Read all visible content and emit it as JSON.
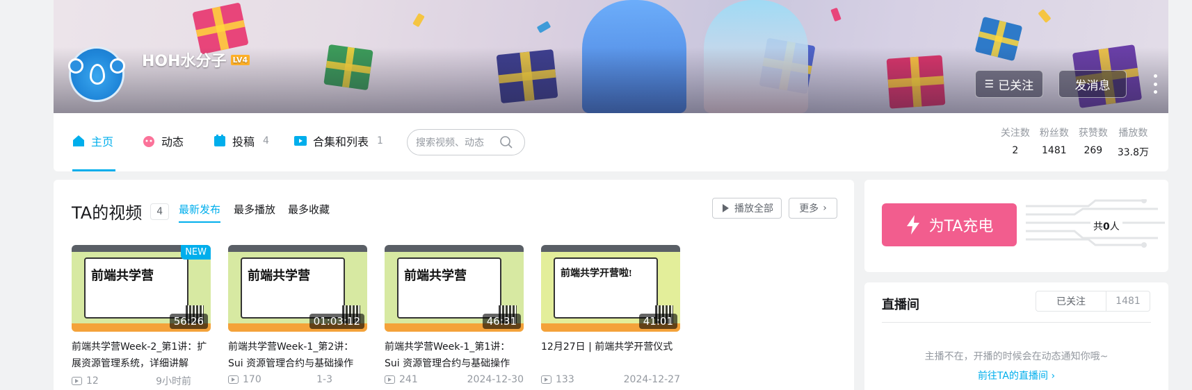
{
  "colors": {
    "accent": "#00aeec",
    "charge": "#f25d8e",
    "text": "#18191c",
    "muted": "#9499a0"
  },
  "profile": {
    "name": "HOH水分子",
    "level": "LV4",
    "followed_label": "已关注",
    "message_label": "发消息"
  },
  "nav": {
    "tabs": [
      {
        "label": "主页",
        "count": "",
        "icon": "home-icon"
      },
      {
        "label": "动态",
        "count": "",
        "icon": "dynamic-icon"
      },
      {
        "label": "投稿",
        "count": "4",
        "icon": "upload-icon"
      },
      {
        "label": "合集和列表",
        "count": "1",
        "icon": "collection-icon"
      }
    ],
    "search_placeholder": "搜索视频、动态",
    "stats": [
      {
        "label": "关注数",
        "value": "2"
      },
      {
        "label": "粉丝数",
        "value": "1481"
      },
      {
        "label": "获赞数",
        "value": "269"
      },
      {
        "label": "播放数",
        "value": "33.8万"
      }
    ]
  },
  "videos_section": {
    "title": "TA的视频",
    "count": "4",
    "sorts": [
      "最新发布",
      "最多播放",
      "最多收藏"
    ],
    "play_all_label": "播放全部",
    "more_label": "更多",
    "items": [
      {
        "title": "前端共学营Week-2_第1讲：扩展资源管理系统，详细讲解",
        "views": "12",
        "date": "9小时前",
        "duration": "56:26",
        "badge": "NEW",
        "thumb_title": "前端共学营"
      },
      {
        "title": "前端共学营Week-1_第2讲：Sui 资源管理合约与基础操作",
        "views": "170",
        "date": "1-3",
        "duration": "01:03:12",
        "badge": "",
        "thumb_title": "前端共学营"
      },
      {
        "title": "前端共学营Week-1_第1讲：Sui 资源管理合约与基础操作",
        "views": "241",
        "date": "2024-12-30",
        "duration": "46:31",
        "badge": "",
        "thumb_title": "前端共学营"
      },
      {
        "title": "12月27日 | 前端共学开营仪式",
        "views": "133",
        "date": "2024-12-27",
        "duration": "41:01",
        "badge": "",
        "thumb_title": "前端共学开营啦!"
      }
    ]
  },
  "charge": {
    "button_label": "为TA充电",
    "count_prefix": "共",
    "count_value": "0",
    "count_suffix": "人"
  },
  "live": {
    "title": "直播间",
    "followed_label": "已关注",
    "followers": "1481",
    "message": "主播不在，开播的时候会在动态通知你哦~",
    "link": "前往TA的直播间"
  }
}
